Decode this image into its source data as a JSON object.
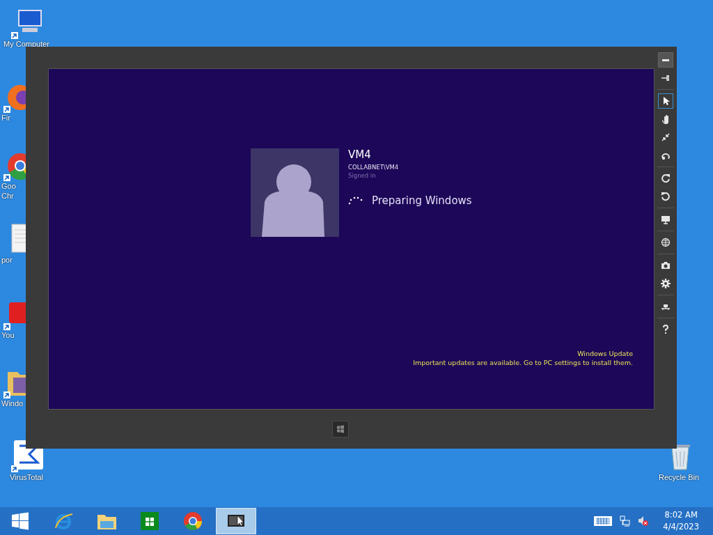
{
  "desktop_icons": [
    {
      "label": "My Computer",
      "kind": "computer"
    },
    {
      "label": "Fir",
      "kind": "browser-orange"
    },
    {
      "label": "Goo\nChr",
      "kind": "browser-ring"
    },
    {
      "label": "por",
      "kind": "document"
    },
    {
      "label": "You",
      "kind": "video"
    },
    {
      "label": "Windo",
      "kind": "folder"
    },
    {
      "label": "VirusTotal",
      "kind": "sigma"
    },
    {
      "label": "Recycle Bin",
      "kind": "bin"
    }
  ],
  "vm_window": {
    "user": {
      "name": "VM4",
      "account": "COLLABNET\\VM4",
      "status": "Signed in"
    },
    "progress_text": "Preparing Windows",
    "notification": {
      "title": "Windows Update",
      "message": "Important updates are available. Go to PC settings to install them."
    },
    "toolbar": [
      {
        "kind": "minimize",
        "selected": false
      },
      {
        "kind": "pin",
        "selected": false
      },
      {
        "kind": "pointer",
        "selected": true
      },
      {
        "kind": "hand",
        "selected": false
      },
      {
        "kind": "arrows",
        "selected": false
      },
      {
        "kind": "swirl",
        "selected": false
      },
      {
        "kind": "rotate-cw",
        "selected": false
      },
      {
        "kind": "rotate-ccw",
        "selected": false
      },
      {
        "kind": "monitor",
        "selected": false
      },
      {
        "kind": "globe",
        "selected": false
      },
      {
        "kind": "camera",
        "selected": false
      },
      {
        "kind": "gear",
        "selected": false
      },
      {
        "kind": "network",
        "selected": false
      },
      {
        "kind": "help",
        "selected": false
      }
    ]
  },
  "taskbar": {
    "apps": [
      {
        "kind": "start",
        "selected": false
      },
      {
        "kind": "ie",
        "selected": false
      },
      {
        "kind": "explorer",
        "selected": false
      },
      {
        "kind": "store",
        "selected": false
      },
      {
        "kind": "chrome",
        "selected": false
      },
      {
        "kind": "vm",
        "selected": true
      }
    ],
    "time": "8:02 AM",
    "date": "4/4/2023"
  }
}
